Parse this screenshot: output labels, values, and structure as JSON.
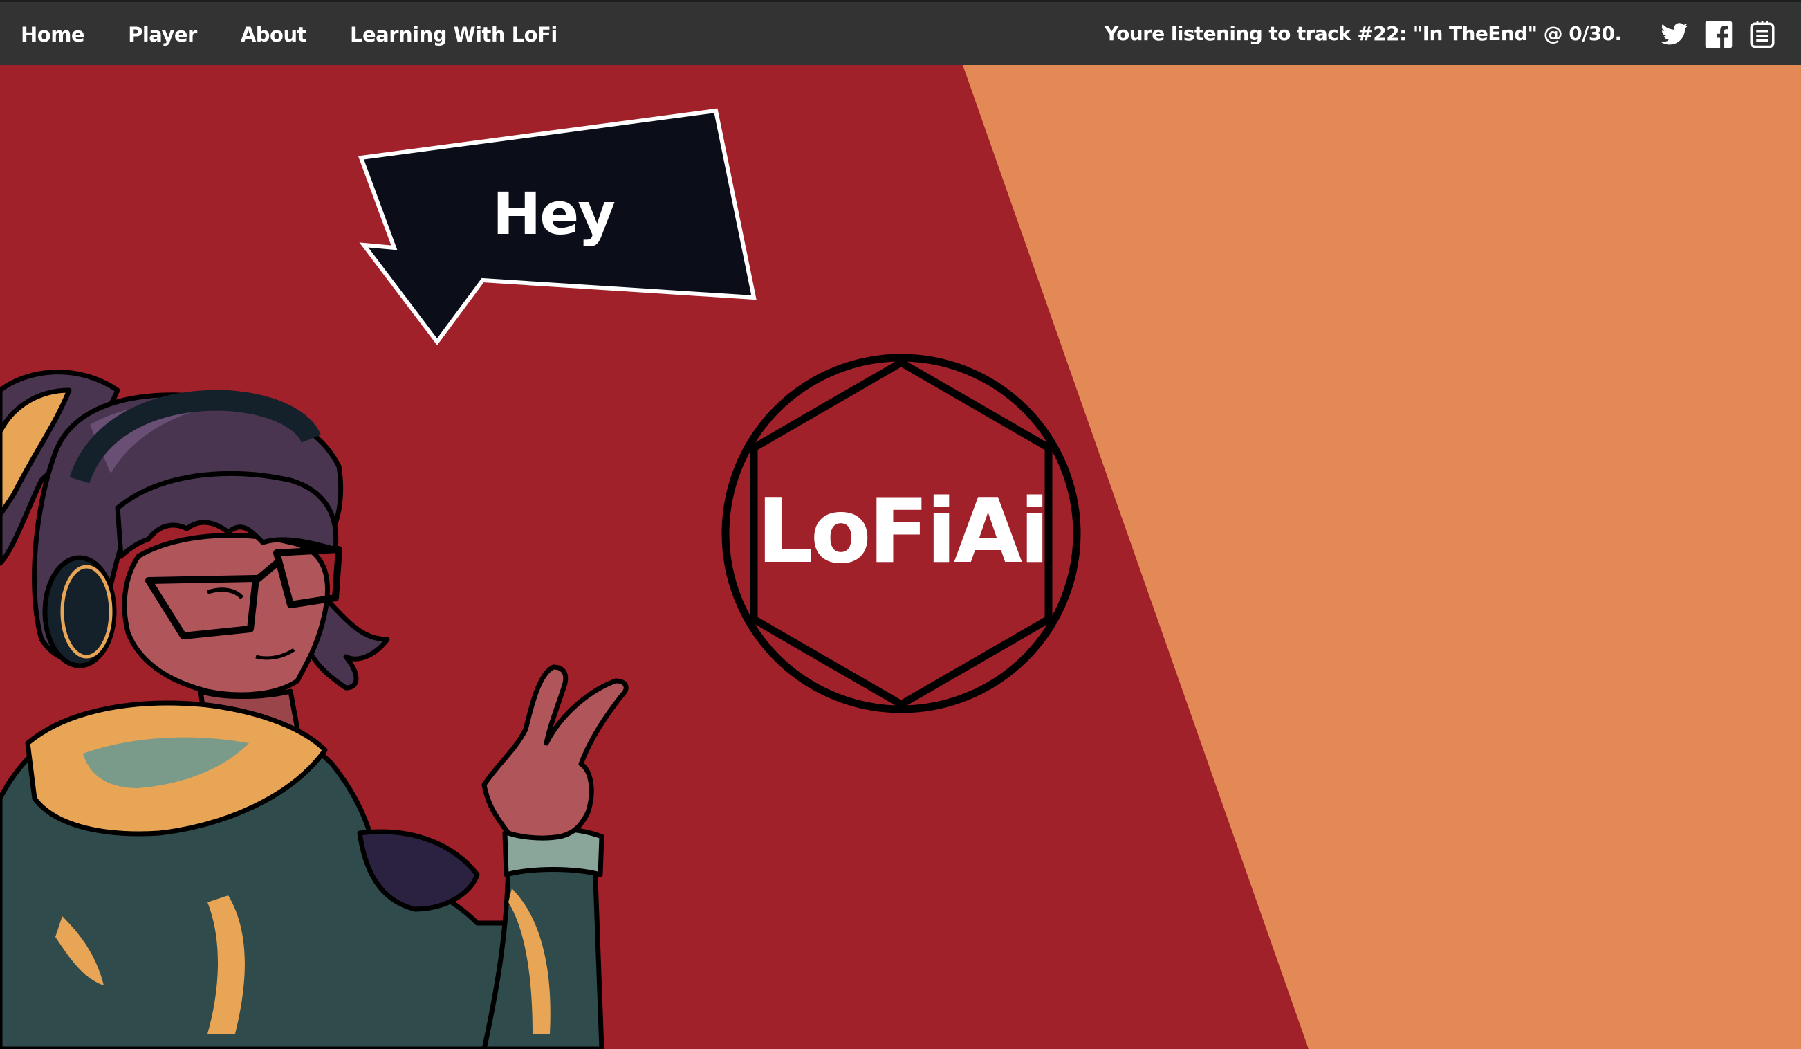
{
  "nav": {
    "links": [
      "Home",
      "Player",
      "About",
      "Learning With LoFi"
    ]
  },
  "now_playing": {
    "text": "Youre listening to track #22: \"In TheEnd\" @ 0/30."
  },
  "social": {
    "icons": [
      "twitter-icon",
      "facebook-icon",
      "notes-icon"
    ]
  },
  "hero": {
    "bubble_text": "Hey",
    "logo_text": "LoFiAi"
  },
  "colors": {
    "navbar": "#333333",
    "red_panel": "#a0212a",
    "orange_panel": "#e28955",
    "bubble": "#0b0e19"
  }
}
